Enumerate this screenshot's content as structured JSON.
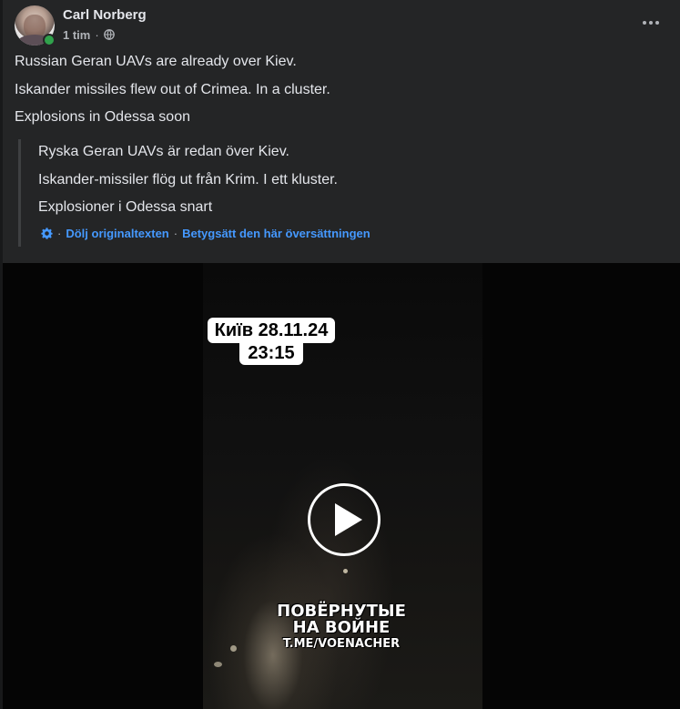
{
  "post": {
    "author": "Carl Norberg",
    "time": "1 tim",
    "separator": "·",
    "privacy_icon": "globe-icon",
    "more_icon": "more-horizontal-icon",
    "online": true
  },
  "body": {
    "lines": [
      "Russian Geran UAVs are already over Kiev.",
      "Iskander missiles flew out of Crimea. In a cluster.",
      "Explosions in Odessa soon"
    ]
  },
  "translation": {
    "lines": [
      "Ryska Geran UAVs är redan över Kiev.",
      "Iskander-missiler flög ut från Krim. I ett kluster.",
      "Explosioner i Odessa snart"
    ],
    "settings_icon": "gear-icon",
    "separator": "·",
    "hide_original": "Dölj originaltexten",
    "rate_translation": "Betygsätt den här översättningen"
  },
  "video": {
    "stamp_date": "Київ 28.11.24",
    "stamp_time": "23:15",
    "watermark_line1": "ПОВЁРНУТЫЕ",
    "watermark_line2": "НА ВОЙНЕ",
    "watermark_line3": "T.ME/VOENACHER",
    "play_icon": "play-icon"
  },
  "colors": {
    "background": "#242526",
    "text": "#e4e6eb",
    "secondary_text": "#b0b3b8",
    "link": "#4599ff",
    "online": "#31a24c"
  }
}
